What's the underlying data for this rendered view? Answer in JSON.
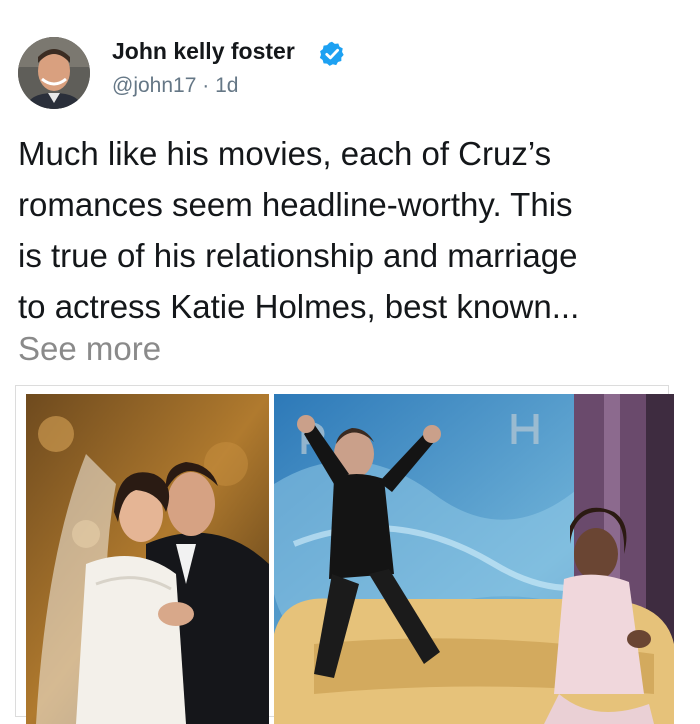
{
  "author": {
    "display_name": "John kelly foster",
    "handle": "@john17",
    "separator": "·",
    "age": "1d",
    "verified": true
  },
  "tweet": {
    "lines": [
      "Much like his movies, each of Cruz’s",
      "romances seem headline-worthy. This",
      "is true of his relationship and marriage",
      "to actress Katie Holmes, best known..."
    ],
    "see_more": "See more"
  },
  "media": {
    "left_photo": "wedding-photo",
    "right_photo": "talk-show-couch-photo"
  },
  "colors": {
    "verified_blue": "#1da1f2",
    "handle_gray": "#657786",
    "see_more_gray": "#8a8a8a",
    "text": "#14171a"
  }
}
